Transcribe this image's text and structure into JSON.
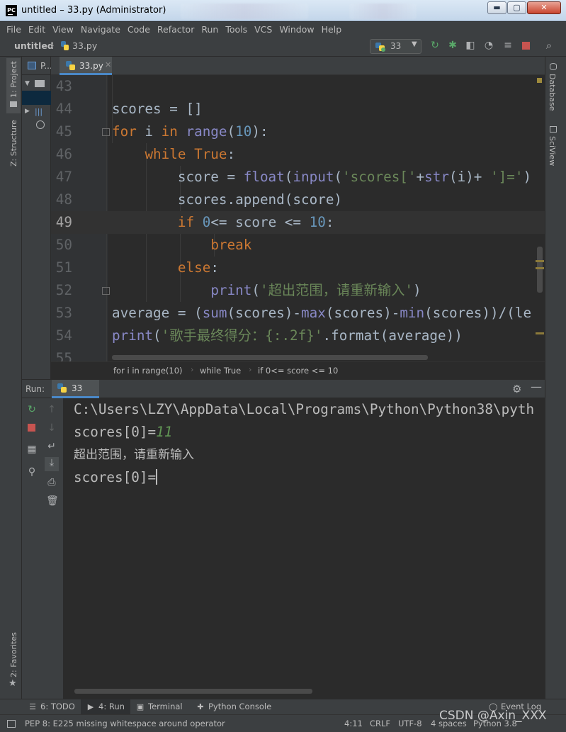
{
  "window": {
    "title": "untitled – 33.py (Administrator)",
    "app_icon": "PC",
    "minimize_glyph": "▬",
    "maximize_glyph": "▢",
    "close_glyph": "✕"
  },
  "menu": [
    "File",
    "Edit",
    "View",
    "Navigate",
    "Code",
    "Refactor",
    "Run",
    "Tools",
    "VCS",
    "Window",
    "Help"
  ],
  "navbar": {
    "project": "untitled",
    "file": "33.py",
    "run_config": "33"
  },
  "left_tabs": {
    "project": "1: Project",
    "structure": "Z: Structure",
    "favorites": "2: Favorites"
  },
  "right_tabs": {
    "database": "Database",
    "sciview": "SciView"
  },
  "project_panel": {
    "label": "P..."
  },
  "editor": {
    "tab_label": "33.py",
    "lines": [
      {
        "n": "43",
        "text": ""
      },
      {
        "n": "44",
        "text": "scores = []"
      },
      {
        "n": "45",
        "text": "for i in range(10):"
      },
      {
        "n": "46",
        "text": "    while True:"
      },
      {
        "n": "47",
        "text": "        score = float(input('scores['+str(i)+ ']=')"
      },
      {
        "n": "48",
        "text": "        scores.append(score)"
      },
      {
        "n": "49",
        "text": "        if 0<= score <= 10:"
      },
      {
        "n": "50",
        "text": "            break"
      },
      {
        "n": "51",
        "text": "        else:"
      },
      {
        "n": "52",
        "text": "            print('超出范围，请重新输入')"
      },
      {
        "n": "53",
        "text": "average = (sum(scores)-max(scores)-min(scores))/(le"
      },
      {
        "n": "54",
        "text": "print('歌手最终得分：{:.2f}'.format(average))"
      },
      {
        "n": "55",
        "text": ""
      }
    ]
  },
  "breadcrumb": [
    "for i in range(10)",
    "while True",
    "if 0<= score <= 10"
  ],
  "run": {
    "label": "Run:",
    "tab": "33",
    "console": {
      "path": "C:\\Users\\LZY\\AppData\\Local\\Programs\\Python\\Python38\\pyth",
      "prompt1": "scores[0]=",
      "input1": "11",
      "message": "超出范围，请重新输入",
      "prompt2": "scores[0]="
    }
  },
  "bottom_tools": {
    "todo": "6: TODO",
    "run": "4: Run",
    "terminal": "Terminal",
    "python_console": "Python Console",
    "event_log": "Event Log"
  },
  "status": {
    "message": "PEP 8: E225 missing whitespace around operator",
    "position": "4:11",
    "line_sep": "CRLF",
    "encoding": "UTF-8",
    "indent": "4 spaces",
    "interpreter": "Python 3.8"
  },
  "watermark": "CSDN @Axin_XXX",
  "colors": {
    "keyword": "#cc7832",
    "builtin": "#8888c6",
    "number": "#6897bb",
    "string": "#6a8759",
    "identifier": "#a9b7c6",
    "user_input": "#629755",
    "accent": "#4a88c7"
  }
}
